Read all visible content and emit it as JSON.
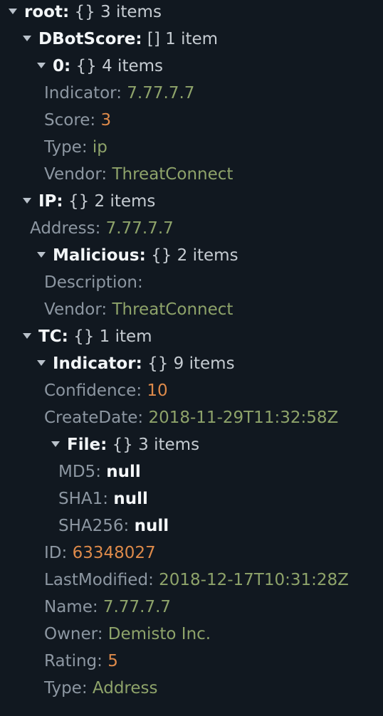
{
  "tree": {
    "root": {
      "key": "root",
      "colon": ":",
      "meta": "{} 3 items"
    },
    "dbotscore": {
      "key": "DBotScore",
      "colon": ":",
      "meta": "[] 1 item"
    },
    "dbot0": {
      "key": "0",
      "colon": ":",
      "meta": "{} 4 items"
    },
    "dbot0_indicator": {
      "key": "Indicator",
      "colon": ":",
      "value": "7.77.7.7"
    },
    "dbot0_score": {
      "key": "Score",
      "colon": ":",
      "value": "3"
    },
    "dbot0_type": {
      "key": "Type",
      "colon": ":",
      "value": "ip"
    },
    "dbot0_vendor": {
      "key": "Vendor",
      "colon": ":",
      "value": "ThreatConnect"
    },
    "ip": {
      "key": "IP",
      "colon": ":",
      "meta": "{} 2 items"
    },
    "ip_address": {
      "key": "Address",
      "colon": ":",
      "value": "7.77.7.7"
    },
    "ip_malicious": {
      "key": "Malicious",
      "colon": ":",
      "meta": "{} 2 items"
    },
    "ip_mal_description": {
      "key": "Description",
      "colon": ":"
    },
    "ip_mal_vendor": {
      "key": "Vendor",
      "colon": ":",
      "value": "ThreatConnect"
    },
    "tc": {
      "key": "TC",
      "colon": ":",
      "meta": "{} 1 item"
    },
    "tc_indicator": {
      "key": "Indicator",
      "colon": ":",
      "meta": "{} 9 items"
    },
    "tc_confidence": {
      "key": "Confidence",
      "colon": ":",
      "value": "10"
    },
    "tc_createdate": {
      "key": "CreateDate",
      "colon": ":",
      "value": "2018-11-29T11:32:58Z"
    },
    "tc_file": {
      "key": "File",
      "colon": ":",
      "meta": "{} 3 items"
    },
    "tc_file_md5": {
      "key": "MD5",
      "colon": ":",
      "value": "null"
    },
    "tc_file_sha1": {
      "key": "SHA1",
      "colon": ":",
      "value": "null"
    },
    "tc_file_sha256": {
      "key": "SHA256",
      "colon": ":",
      "value": "null"
    },
    "tc_id": {
      "key": "ID",
      "colon": ":",
      "value": "63348027"
    },
    "tc_lastmodified": {
      "key": "LastModified",
      "colon": ":",
      "value": "2018-12-17T10:31:28Z"
    },
    "tc_name": {
      "key": "Name",
      "colon": ":",
      "value": "7.77.7.7"
    },
    "tc_owner": {
      "key": "Owner",
      "colon": ":",
      "value": "Demisto Inc."
    },
    "tc_rating": {
      "key": "Rating",
      "colon": ":",
      "value": "5"
    },
    "tc_type": {
      "key": "Type",
      "colon": ":",
      "value": "Address"
    }
  },
  "colors": {
    "background": "#111820",
    "string": "#8ea36a",
    "number": "#de8a4a",
    "null": "#f4f6f8",
    "key": "#8d97a2"
  },
  "icons": {
    "toggle": "caret-down-icon"
  }
}
